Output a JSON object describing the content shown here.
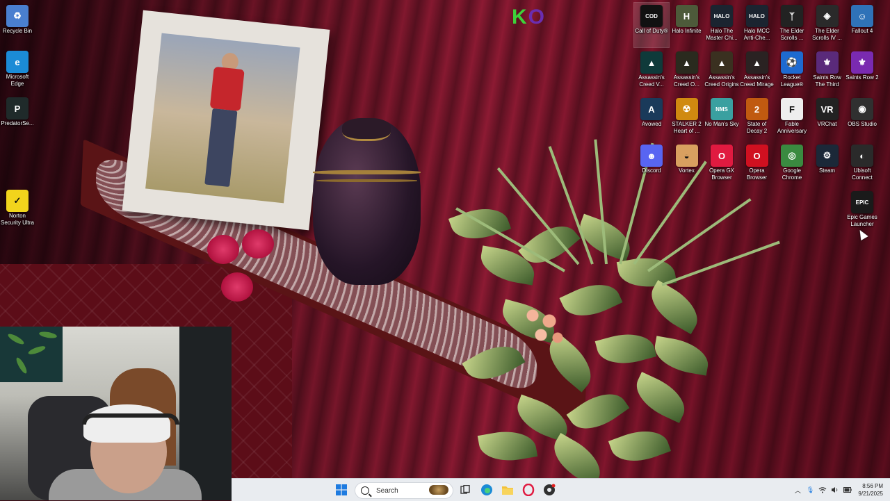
{
  "wallpaper": {
    "logo_k": "K",
    "logo_o": "O"
  },
  "desktop_left": [
    {
      "label": "Recycle Bin",
      "icon": "recycle-bin-icon",
      "glyph": "♻",
      "color": "#4a7fd0"
    },
    {
      "label": "Microsoft Edge",
      "icon": "edge-icon",
      "glyph": "e",
      "color": "#1b8bd6"
    },
    {
      "label": "PredatorSe...",
      "icon": "predator-icon",
      "glyph": "P",
      "color": "#1f2a2a"
    },
    {
      "label": "Norton Security Ultra",
      "icon": "norton-icon",
      "glyph": "✓",
      "color": "#f2d41c"
    }
  ],
  "desktop_grid": [
    [
      {
        "label": "Call of Duty®",
        "icon": "call-of-duty-icon",
        "glyph": "COD",
        "color": "#111111"
      },
      {
        "label": "Halo Infinite",
        "icon": "halo-infinite-icon",
        "glyph": "H",
        "color": "#4d5a3a"
      },
      {
        "label": "Halo The Master Chi...",
        "icon": "halo-mcc-icon",
        "glyph": "HALO",
        "color": "#1b2430"
      },
      {
        "label": "Halo MCC Anti-Che...",
        "icon": "halo-mcc-anticheat-icon",
        "glyph": "HALO",
        "color": "#1b2430"
      },
      {
        "label": "The Elder Scrolls ...",
        "icon": "elder-scrolls-icon",
        "glyph": "ᛉ",
        "color": "#222222"
      },
      {
        "label": "The Elder Scrolls IV ...",
        "icon": "oblivion-icon",
        "glyph": "◈",
        "color": "#2a2a2a"
      },
      {
        "label": "Fallout 4",
        "icon": "fallout-icon",
        "glyph": "☺",
        "color": "#2f72b8"
      }
    ],
    [
      {
        "label": "Assassin's Creed V...",
        "icon": "ac-valhalla-icon",
        "glyph": "▲",
        "color": "#0f3a3a"
      },
      {
        "label": "Assassin's Creed O...",
        "icon": "ac-odyssey-icon",
        "glyph": "▲",
        "color": "#2a2a1e"
      },
      {
        "label": "Assassin's Creed Origins",
        "icon": "ac-origins-icon",
        "glyph": "▲",
        "color": "#3a3020"
      },
      {
        "label": "Assassin's Creed Mirage",
        "icon": "ac-mirage-icon",
        "glyph": "▲",
        "color": "#2a2222"
      },
      {
        "label": "Rocket League®",
        "icon": "rocket-league-icon",
        "glyph": "⚽",
        "color": "#1e6ad0"
      },
      {
        "label": "Saints Row The Third",
        "icon": "saints-row-third-icon",
        "glyph": "⚜",
        "color": "#5a2a7a"
      },
      {
        "label": "Saints Row 2",
        "icon": "saints-row-2-icon",
        "glyph": "⚜",
        "color": "#7a2ab0"
      }
    ],
    [
      {
        "label": "Avowed",
        "icon": "avowed-icon",
        "glyph": "A",
        "color": "#1a3a5a"
      },
      {
        "label": "STALKER 2 Heart of ...",
        "icon": "stalker-icon",
        "glyph": "☢",
        "color": "#d08a10"
      },
      {
        "label": "No Man's Sky",
        "icon": "no-mans-sky-icon",
        "glyph": "NMS",
        "color": "#3aa0a0"
      },
      {
        "label": "State of Decay 2",
        "icon": "state-of-decay-icon",
        "glyph": "2",
        "color": "#c05a10"
      },
      {
        "label": "Fable Anniversary",
        "icon": "fable-icon",
        "glyph": "F",
        "color": "#eeeeee"
      },
      {
        "label": "VRChat",
        "icon": "vrchat-icon",
        "glyph": "VR",
        "color": "#222222"
      },
      {
        "label": "OBS Studio",
        "icon": "obs-icon",
        "glyph": "◉",
        "color": "#303030"
      }
    ],
    [
      {
        "label": "Discord",
        "icon": "discord-icon",
        "glyph": "☻",
        "color": "#5865f2"
      },
      {
        "label": "Vortex",
        "icon": "vortex-icon",
        "glyph": "◒",
        "color": "#d8a060"
      },
      {
        "label": "Opera GX Browser",
        "icon": "opera-gx-icon",
        "glyph": "O",
        "color": "#e01a40"
      },
      {
        "label": "Opera Browser",
        "icon": "opera-icon",
        "glyph": "O",
        "color": "#d01020"
      },
      {
        "label": "Google Chrome",
        "icon": "chrome-icon",
        "glyph": "◎",
        "color": "#3a8a40"
      },
      {
        "label": "Steam",
        "icon": "steam-icon",
        "glyph": "⚙",
        "color": "#1b2838"
      },
      {
        "label": "Ubisoft Connect",
        "icon": "ubisoft-icon",
        "glyph": "◐",
        "color": "#2a2a2a"
      }
    ],
    [
      {
        "label": "Epic Games Launcher",
        "icon": "epic-games-icon",
        "glyph": "EPIC",
        "color": "#1a1a1a"
      }
    ]
  ],
  "taskbar": {
    "search_placeholder": "Search",
    "clock_time": "8:56 PM",
    "clock_date": "9/21/2025"
  },
  "colors": {
    "taskbar_bg": "#e9ecf0",
    "windows_blue": "#1e7be0"
  }
}
